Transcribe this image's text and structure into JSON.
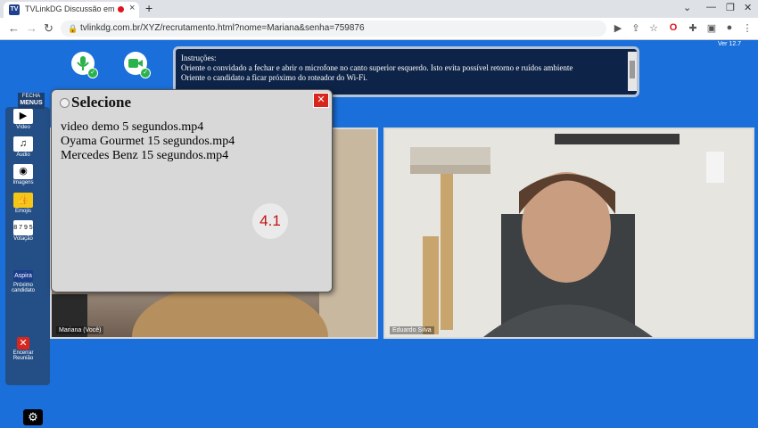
{
  "browser": {
    "tab_title": "TVLinkDG Discussão em Gru",
    "tab_favicon": "TV",
    "url": "tvlinkdg.com.br/XYZ/recrutamento.html?nome=Mariana&senha=759876",
    "icons": [
      "back-icon",
      "forward-icon",
      "reload-icon",
      "lock-icon",
      "camera-icon",
      "share-icon",
      "star-icon",
      "opera-icon",
      "puzzle-icon",
      "sidepanel-icon",
      "profile-icon",
      "menu-icon"
    ]
  },
  "app": {
    "version": "Ver 12.7",
    "instructions": {
      "title": "Instruções:",
      "lines": [
        "Oriente o convidado a fechar e abrir o microfone no canto superior esquerdo. Isto evita possível retorno e ruídos ambiente",
        "Oriente o candidato a ficar próximo do roteador do Wi-Fi."
      ]
    },
    "sidebar": {
      "close_label_1": "FECHA",
      "close_label_2": "MENUS",
      "items": [
        {
          "label": "Vídeo",
          "icon": "film-icon"
        },
        {
          "label": "Áudio",
          "icon": "music-icon"
        },
        {
          "label": "Imagens",
          "icon": "eye-icon"
        },
        {
          "label": "Emojis",
          "icon": "thumbs-up-icon"
        },
        {
          "label": "Votação",
          "icon": "numbers-icon"
        }
      ],
      "next_label_1": "Próximo",
      "next_label_2": "candidato",
      "end_label_1": "Encerrar",
      "end_label_2": "Reunião"
    },
    "videos": {
      "local_label": "Mariana (Você)",
      "remote_label": "Eduardo Silva"
    },
    "dialog": {
      "title": "Selecione",
      "items": [
        "video demo 5 segundos.mp4",
        "Oyama Gourmet 15 segundos.mp4",
        "Mercedes Benz 15 segundos.mp4"
      ],
      "badge": "4.1"
    },
    "colors": {
      "background": "#1a6fdb",
      "sidebar": "#244f86",
      "badge_text": "#c41212"
    }
  }
}
